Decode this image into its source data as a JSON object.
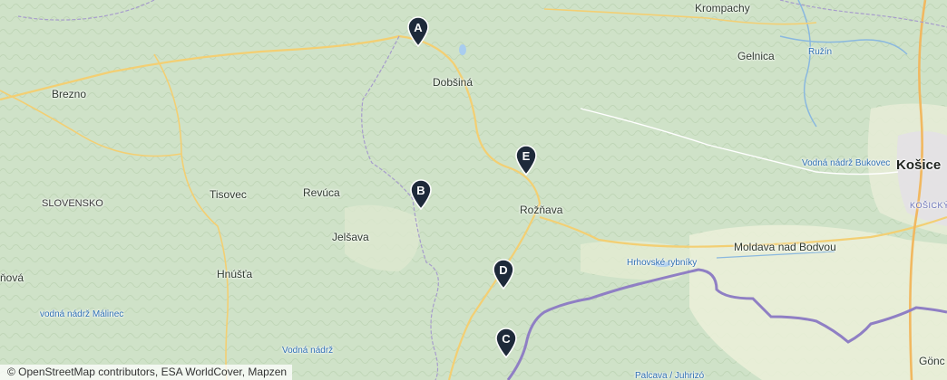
{
  "map": {
    "labels": {
      "krompachy": "Krompachy",
      "gelnica": "Gelnica",
      "ruzin": "Ružín",
      "brezno": "Brezno",
      "dobsina": "Dobšiná",
      "kosice": "Košice",
      "bukovec": "Vodná nádrž Bukovec",
      "kosicky": "KOŠICKÝ",
      "slovensko": "SLOVENSKO",
      "tisovec": "Tisovec",
      "revuca": "Revúca",
      "roznava": "Rožňava",
      "jelsava": "Jelšava",
      "moldava": "Moldava nad Bodvou",
      "hrhov": "Hrhovské rybníky",
      "hnusta": "Hnúšťa",
      "rimavska": "ňová",
      "malinec": "vodná nádrž Málinec",
      "vodna_nadrz": "Vodná nádrž",
      "gonc": "Gönc",
      "palcava": "Palcava / Juhrizó"
    },
    "markers": [
      {
        "letter": "A",
        "color": "#1e2a3a"
      },
      {
        "letter": "B",
        "color": "#1e2a3a"
      },
      {
        "letter": "C",
        "color": "#1e2a3a"
      },
      {
        "letter": "D",
        "color": "#1e2a3a"
      },
      {
        "letter": "E",
        "color": "#1e2a3a"
      }
    ]
  },
  "attribution": "© OpenStreetMap contributors, ESA WorldCover, Mapzen"
}
